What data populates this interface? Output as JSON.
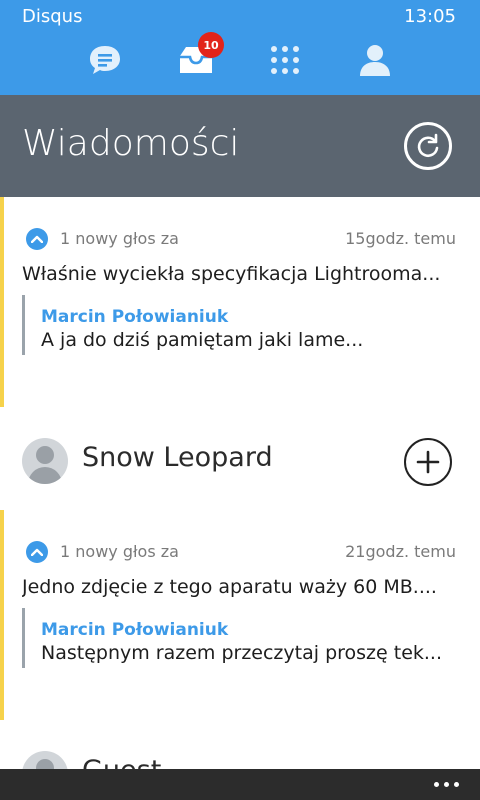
{
  "status_bar": {
    "app_name": "Disqus",
    "time": "13:05"
  },
  "nav": {
    "items": [
      {
        "name": "messages",
        "icon": "chat-bubble-icon"
      },
      {
        "name": "inbox",
        "icon": "inbox-tray-icon",
        "badge": "10"
      },
      {
        "name": "apps",
        "icon": "grid-icon"
      },
      {
        "name": "profile",
        "icon": "user-icon"
      }
    ]
  },
  "header": {
    "title": "Wiadomości",
    "refresh_icon": "refresh-icon"
  },
  "feed": [
    {
      "type": "notification",
      "vote_text": "1 nowy głos za",
      "time": "15godz. temu",
      "title": "Właśnie wyciekła specyfikacja Lightrooma...",
      "quote_author": "Marcin Połowianiuk",
      "quote_text": "A ja do dziś pamiętam jaki lame..."
    },
    {
      "type": "user",
      "name": "Snow Leopard",
      "action_icon": "plus-circle-icon"
    },
    {
      "type": "notification",
      "vote_text": "1 nowy głos za",
      "time": "21godz. temu",
      "title": "Jedno zdjęcie z tego aparatu waży 60 MB....",
      "quote_author": "Marcin Połowianiuk",
      "quote_text": "Następnym razem przeczytaj proszę tek..."
    },
    {
      "type": "user",
      "name": "Guest"
    }
  ],
  "colors": {
    "accent": "#3d9ae8",
    "header_bg": "#5b6570",
    "unread_marker": "#f6d24b",
    "badge": "#e2231a",
    "appbar": "#2c2c2c"
  }
}
